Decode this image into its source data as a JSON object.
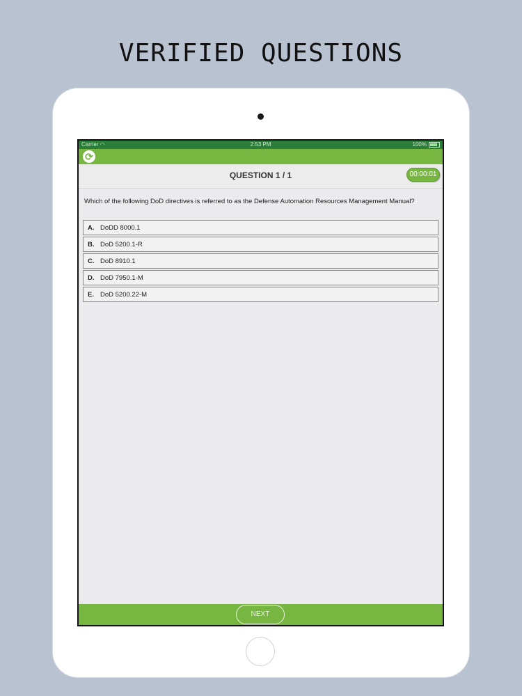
{
  "headline": "VERIFIED QUESTIONS",
  "statusbar": {
    "carrier": "Carrier",
    "time": "2:53 PM",
    "battery": "100%"
  },
  "toolbar": {
    "refresh_icon": "refresh-icon"
  },
  "question": {
    "title": "QUESTION 1 / 1",
    "timer": "00:00:01",
    "text": "Which of the following DoD directives is referred to as the Defense Automation Resources Management Manual?"
  },
  "answers": [
    {
      "letter": "A.",
      "text": "DoDD 8000.1"
    },
    {
      "letter": "B.",
      "text": "DoD 5200.1-R"
    },
    {
      "letter": "C.",
      "text": "DoD 8910.1"
    },
    {
      "letter": "D.",
      "text": "DoD 7950.1-M"
    },
    {
      "letter": "E.",
      "text": "DoD 5200.22-M"
    }
  ],
  "footer": {
    "next_label": "NEXT"
  },
  "colors": {
    "accent": "#77b640",
    "background": "#b8c2d0"
  }
}
